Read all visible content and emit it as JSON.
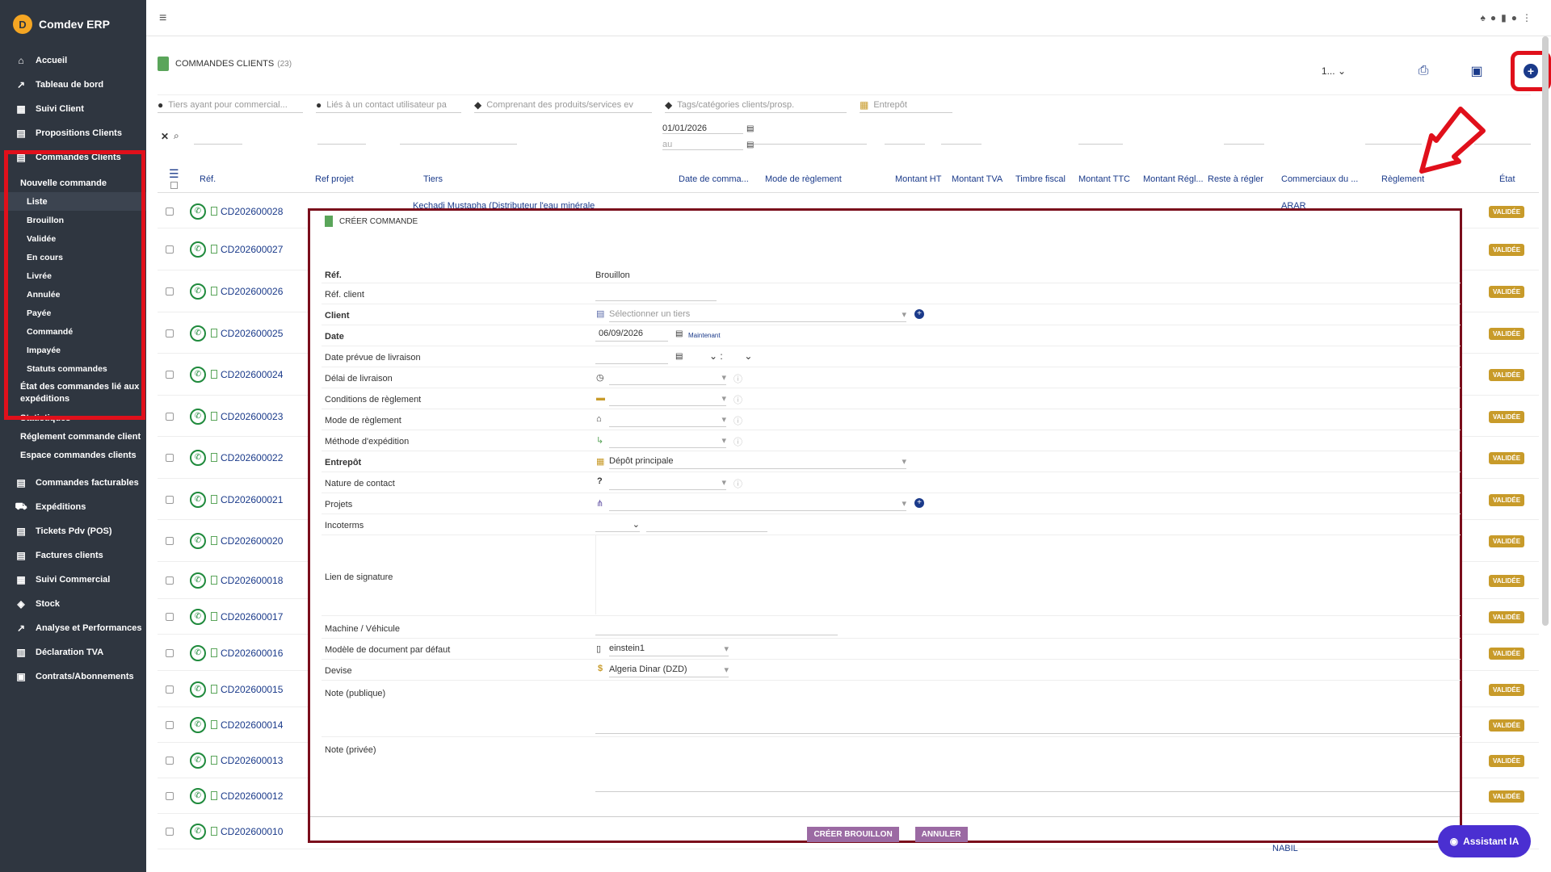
{
  "app": {
    "name": "Comdev ERP",
    "logo_letter": "D"
  },
  "sidebar": {
    "items": [
      {
        "label": "Accueil",
        "icon": "home-icon"
      },
      {
        "label": "Tableau de bord",
        "icon": "chart-line-icon"
      },
      {
        "label": "Suivi Client",
        "icon": "building-icon"
      },
      {
        "label": "Propositions Clients",
        "icon": "file-icon"
      },
      {
        "label": "Commandes Clients",
        "icon": "file-icon"
      }
    ],
    "sub": [
      {
        "label": "Nouvelle commande"
      },
      {
        "label": "Liste"
      },
      {
        "label": "Brouillon"
      },
      {
        "label": "Validée"
      },
      {
        "label": "En cours"
      },
      {
        "label": "Livrée"
      },
      {
        "label": "Annulée"
      },
      {
        "label": "Payée"
      },
      {
        "label": "Commandé"
      },
      {
        "label": "Impayée"
      },
      {
        "label": "Statuts commandes"
      },
      {
        "label": "État des commandes lié aux expéditions"
      },
      {
        "label": "Statistiques"
      },
      {
        "label": "Réglement commande client"
      },
      {
        "label": "Espace commandes clients"
      }
    ],
    "items2": [
      {
        "label": "Commandes facturables",
        "icon": "file-icon"
      },
      {
        "label": "Expéditions",
        "icon": "truck-icon"
      },
      {
        "label": "Tickets Pdv (POS)",
        "icon": "file-icon"
      },
      {
        "label": "Factures clients",
        "icon": "file-icon"
      },
      {
        "label": "Suivi Commercial",
        "icon": "building-icon"
      },
      {
        "label": "Stock",
        "icon": "box-icon"
      },
      {
        "label": "Analyse et Performances",
        "icon": "chart-line-icon"
      },
      {
        "label": "Déclaration TVA",
        "icon": "table-icon"
      },
      {
        "label": "Contrats/Abonnements",
        "icon": "briefcase-icon"
      }
    ]
  },
  "page": {
    "title": "COMMANDES CLIENTS",
    "count": "(23)",
    "per_page": "1..."
  },
  "filters": {
    "commercial_ph": "Tiers ayant pour commercial...",
    "contact_ph": "Liés à un contact utilisateur pa",
    "products_ph": "Comprenant des produits/services ev",
    "tags_ph": "Tags/catégories clients/prosp.",
    "warehouse_ph": "Entrepôt",
    "date_from": "01/01/2026",
    "date_to_ph": "au"
  },
  "columns": [
    "Réf.",
    "Ref projet",
    "Tiers",
    "Date de comma...",
    "Mode de règlement",
    "Montant HT",
    "Montant TVA",
    "Timbre fiscal",
    "Montant TTC",
    "Montant Régl...",
    "Reste à régler",
    "Commerciaux du ...",
    "Règlement",
    "État"
  ],
  "rows": [
    {
      "ref": "CD202600028",
      "status": "VALIDÉE"
    },
    {
      "ref": "CD202600027",
      "status": "VALIDÉE"
    },
    {
      "ref": "CD202600026",
      "status": "VALIDÉE"
    },
    {
      "ref": "CD202600025",
      "status": "VALIDÉE"
    },
    {
      "ref": "CD202600024",
      "status": "VALIDÉE"
    },
    {
      "ref": "CD202600023",
      "status": "VALIDÉE"
    },
    {
      "ref": "CD202600022",
      "status": "VALIDÉE"
    },
    {
      "ref": "CD202600021",
      "status": "VALIDÉE"
    },
    {
      "ref": "CD202600020",
      "status": "VALIDÉE"
    },
    {
      "ref": "CD202600018",
      "status": "VALIDÉE"
    },
    {
      "ref": "CD202600017",
      "status": "VALIDÉE"
    },
    {
      "ref": "CD202600016",
      "status": "VALIDÉE"
    },
    {
      "ref": "CD202600015",
      "status": "VALIDÉE"
    },
    {
      "ref": "CD202600014",
      "status": "VALIDÉE"
    },
    {
      "ref": "CD202600013",
      "status": "VALIDÉE"
    },
    {
      "ref": "CD202600012",
      "status": "VALIDÉE"
    },
    {
      "ref": "CD202600010",
      "status": ""
    }
  ],
  "row_visible": {
    "tiers": "Kechadi Mustapha (Distributeur l'eau minérale",
    "commercial": "ARAR",
    "commercial_last": "NABIL"
  },
  "modal": {
    "title": "CRÉER COMMANDE",
    "fields": {
      "ref_label": "Réf.",
      "ref_value": "Brouillon",
      "ref_client_label": "Réf. client",
      "client_label": "Client",
      "client_ph": "Sélectionner un tiers",
      "date_label": "Date",
      "date_value": "06/09/2026",
      "now_link": "Maintenant",
      "delivery_date_label": "Date prévue de livraison",
      "delivery_delay_label": "Délai de livraison",
      "payment_terms_label": "Conditions de règlement",
      "payment_mode_label": "Mode de règlement",
      "shipping_method_label": "Méthode d'expédition",
      "warehouse_label": "Entrepôt",
      "warehouse_value": "Dépôt principale",
      "contact_nature_label": "Nature de contact",
      "projects_label": "Projets",
      "incoterms_label": "Incoterms",
      "signature_label": "Lien de signature",
      "machine_label": "Machine / Véhicule",
      "doc_model_label": "Modèle de document par défaut",
      "doc_model_value": "einstein1",
      "currency_label": "Devise",
      "currency_value": "Algeria Dinar (DZD)",
      "note_public_label": "Note (publique)",
      "note_private_label": "Note (privée)"
    },
    "buttons": {
      "create_draft": "CRÉER BROUILLON",
      "cancel": "ANNULER"
    }
  },
  "assistant": {
    "label": "Assistant IA"
  }
}
